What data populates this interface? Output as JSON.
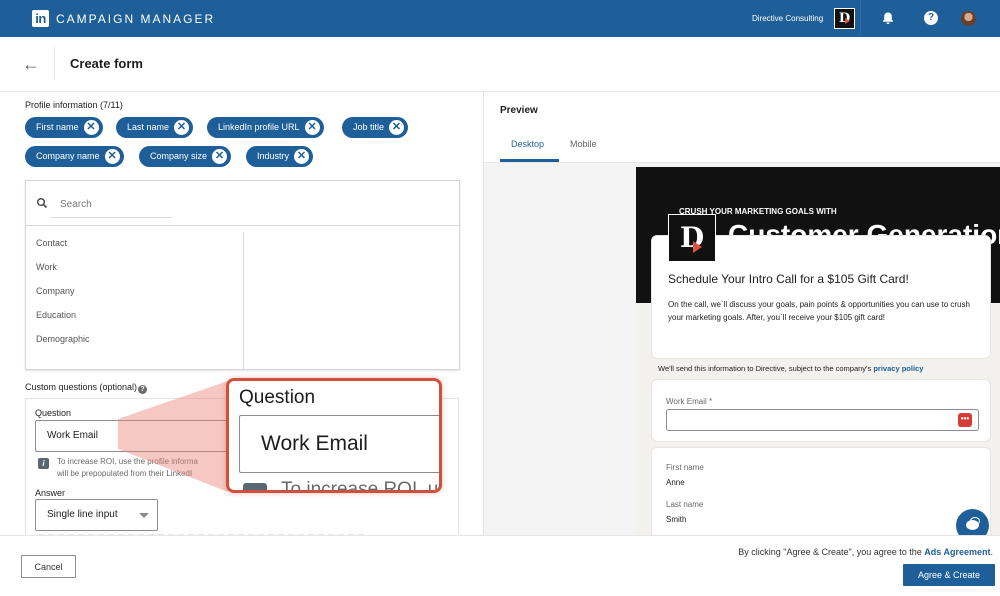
{
  "topnav": {
    "logo_text": "in",
    "app_name": "CAMPAIGN MANAGER",
    "account_name": "Directive Consulting",
    "account_logo_letter": "D",
    "help_glyph": "?",
    "icons": [
      "linkedin-logo-icon",
      "bell-icon",
      "help-icon",
      "avatar"
    ]
  },
  "header": {
    "back_glyph": "←",
    "title": "Create form"
  },
  "profile_info": {
    "label": "Profile information (7/11)",
    "chips": [
      {
        "label": "First name"
      },
      {
        "label": "Last name"
      },
      {
        "label": "LinkedIn profile URL"
      },
      {
        "label": "Job title"
      },
      {
        "label": "Company name"
      },
      {
        "label": "Company size"
      },
      {
        "label": "Industry"
      }
    ],
    "remove_glyph": "✕"
  },
  "picker": {
    "search_placeholder": "Search",
    "categories": [
      "Contact",
      "Work",
      "Company",
      "Education",
      "Demographic"
    ]
  },
  "custom_questions": {
    "label": "Custom questions (optional)",
    "help_glyph": "?",
    "question_label": "Question",
    "question_value": "Work Email",
    "info_glyph": "i",
    "info_text_line1": "To increase ROI, use the profile informa",
    "info_text_line2": "will be prepopulated from their LinkedI",
    "answer_label": "Answer",
    "answer_value": "Single line input"
  },
  "callout": {
    "question_label": "Question",
    "question_value": "Work Email",
    "info_text": "To increase ROI, us",
    "accent_color": "#d1503d"
  },
  "preview": {
    "title": "Preview",
    "tabs": [
      {
        "label": "Desktop",
        "active": true
      },
      {
        "label": "Mobile",
        "active": false
      }
    ],
    "hero_kicker": "CRUSH YOUR MARKETING GOALS WITH",
    "hero_big": "Customer Generation",
    "brand_letter": "D",
    "intro_title": "Schedule Your Intro Call for a $105 Gift Card!",
    "intro_body": "On the call, we`ll discuss your goals, pain points & opportunities you can use to crush your marketing goals. After, you`ll receive your $105 gift card!",
    "privacy_text": "We'll send this information to Directive, subject to the company's",
    "privacy_link": "privacy policy",
    "email_label": "Work Email *",
    "password_icon_glyph": "•••",
    "fields": [
      {
        "label": "First name",
        "value": "Anne"
      },
      {
        "label": "Last name",
        "value": "Smith"
      }
    ]
  },
  "footer": {
    "cancel_label": "Cancel",
    "legal_text": "By clicking \"Agree & Create\", you agree to the",
    "legal_link": "Ads Agreement",
    "legal_suffix": ".",
    "create_label": "Agree & Create"
  },
  "colors": {
    "brand_blue": "#1e5f99",
    "callout_red": "#d1503d",
    "brand_orange": "#e0513f"
  }
}
